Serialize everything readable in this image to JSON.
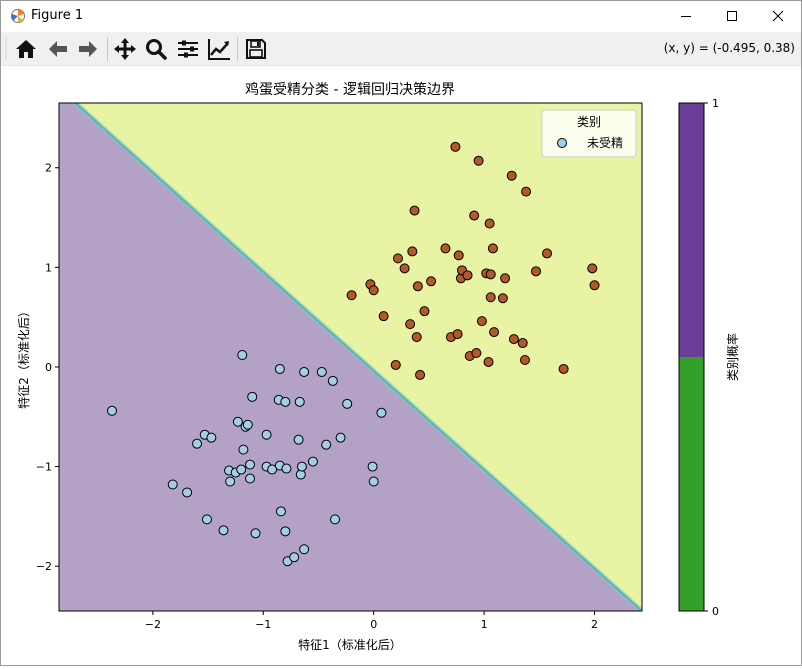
{
  "window": {
    "title": "Figure 1"
  },
  "toolbar": {
    "buttons": [
      "home-icon",
      "back-icon",
      "forward-icon",
      "pan-icon",
      "zoom-icon",
      "subplots-icon",
      "edit-axis-icon",
      "save-icon"
    ],
    "coords": "(x, y) = (-0.495, 0.38)"
  },
  "colors": {
    "region_low": "#b3a2c6",
    "region_high": "#e9f3a4",
    "boundary_teal": "#5fb7a3",
    "boundary_blue": "#7dc6d9",
    "class0_fill": "#a6cee3",
    "class1_fill": "#b15928",
    "colorbar_low": "#33a02c",
    "colorbar_high": "#6a3d9a"
  },
  "chart_data": {
    "type": "scatter",
    "title": "鸡蛋受精分类 - 逻辑回归决策边界",
    "xlabel": "特征1（标准化后）",
    "ylabel": "特征2（标准化后）",
    "xlim": [
      -2.85,
      2.43
    ],
    "ylim": [
      -2.45,
      2.65
    ],
    "xticks": [
      -2,
      -1,
      0,
      1,
      2
    ],
    "yticks": [
      -2,
      -1,
      0,
      1,
      2
    ],
    "decision_boundary": {
      "description_free": true,
      "points": [
        [
          -2.7,
          2.65
        ],
        [
          -1.5,
          1.45
        ],
        [
          2.43,
          -2.45
        ]
      ]
    },
    "legend": {
      "title": "类别",
      "entries": [
        "未受精"
      ],
      "loc": "upper right"
    },
    "colorbar": {
      "label": "类别概率",
      "ticks": [
        "0",
        "1"
      ],
      "split": 0.5
    },
    "series": [
      {
        "name": "未受精",
        "points": [
          [
            -2.37,
            -0.44
          ],
          [
            -1.82,
            -1.18
          ],
          [
            -1.69,
            -1.26
          ],
          [
            -1.6,
            -0.77
          ],
          [
            -1.53,
            -0.68
          ],
          [
            -1.47,
            -0.71
          ],
          [
            -1.51,
            -1.53
          ],
          [
            -1.36,
            -1.64
          ],
          [
            -1.3,
            -1.15
          ],
          [
            -1.31,
            -1.04
          ],
          [
            -1.25,
            -1.06
          ],
          [
            -1.23,
            -0.55
          ],
          [
            -1.2,
            -1.03
          ],
          [
            -1.18,
            -0.83
          ],
          [
            -1.16,
            -0.6
          ],
          [
            -1.14,
            -0.58
          ],
          [
            -1.12,
            -0.98
          ],
          [
            -1.1,
            -0.3
          ],
          [
            -1.12,
            -1.12
          ],
          [
            -1.19,
            0.12
          ],
          [
            -1.07,
            -1.67
          ],
          [
            -0.97,
            -0.68
          ],
          [
            -0.97,
            -1.0
          ],
          [
            -0.92,
            -1.03
          ],
          [
            -0.86,
            -0.33
          ],
          [
            -0.85,
            -0.02
          ],
          [
            -0.85,
            -0.99
          ],
          [
            -0.84,
            -1.45
          ],
          [
            -0.8,
            -0.35
          ],
          [
            -0.79,
            -1.02
          ],
          [
            -0.8,
            -1.65
          ],
          [
            -0.78,
            -1.95
          ],
          [
            -0.72,
            -1.91
          ],
          [
            -0.68,
            -0.73
          ],
          [
            -0.67,
            -0.35
          ],
          [
            -0.66,
            -1.08
          ],
          [
            -0.65,
            -1.0
          ],
          [
            -0.63,
            -0.05
          ],
          [
            -0.63,
            -1.83
          ],
          [
            -0.55,
            -0.95
          ],
          [
            -0.47,
            -0.05
          ],
          [
            -0.43,
            -0.78
          ],
          [
            -0.37,
            -0.14
          ],
          [
            -0.35,
            -1.53
          ],
          [
            -0.3,
            -0.71
          ],
          [
            -0.24,
            -0.37
          ],
          [
            -0.01,
            -1.0
          ],
          [
            0.0,
            -1.15
          ],
          [
            0.07,
            -0.46
          ]
        ]
      },
      {
        "points": [
          [
            -0.2,
            0.72
          ],
          [
            -0.03,
            0.83
          ],
          [
            0.0,
            0.77
          ],
          [
            0.09,
            0.51
          ],
          [
            0.2,
            0.02
          ],
          [
            0.22,
            1.09
          ],
          [
            0.28,
            0.99
          ],
          [
            0.33,
            0.43
          ],
          [
            0.35,
            1.16
          ],
          [
            0.37,
            1.57
          ],
          [
            0.39,
            0.3
          ],
          [
            0.4,
            0.81
          ],
          [
            0.42,
            -0.08
          ],
          [
            0.46,
            0.56
          ],
          [
            0.52,
            0.86
          ],
          [
            0.65,
            1.19
          ],
          [
            0.7,
            0.3
          ],
          [
            0.74,
            2.21
          ],
          [
            0.76,
            0.33
          ],
          [
            0.77,
            1.12
          ],
          [
            0.79,
            0.89
          ],
          [
            0.8,
            0.97
          ],
          [
            0.85,
            0.92
          ],
          [
            0.87,
            0.11
          ],
          [
            0.91,
            1.52
          ],
          [
            0.93,
            0.14
          ],
          [
            0.95,
            2.07
          ],
          [
            0.98,
            0.46
          ],
          [
            1.02,
            0.94
          ],
          [
            1.04,
            0.05
          ],
          [
            1.05,
            1.44
          ],
          [
            1.06,
            0.7
          ],
          [
            1.06,
            0.93
          ],
          [
            1.08,
            1.19
          ],
          [
            1.09,
            0.35
          ],
          [
            1.17,
            0.69
          ],
          [
            1.19,
            0.89
          ],
          [
            1.25,
            1.92
          ],
          [
            1.27,
            0.28
          ],
          [
            1.35,
            0.24
          ],
          [
            1.37,
            0.07
          ],
          [
            1.38,
            1.76
          ],
          [
            1.47,
            0.96
          ],
          [
            1.57,
            1.14
          ],
          [
            1.72,
            -0.02
          ],
          [
            1.98,
            0.99
          ],
          [
            2.0,
            0.82
          ]
        ]
      }
    ]
  }
}
